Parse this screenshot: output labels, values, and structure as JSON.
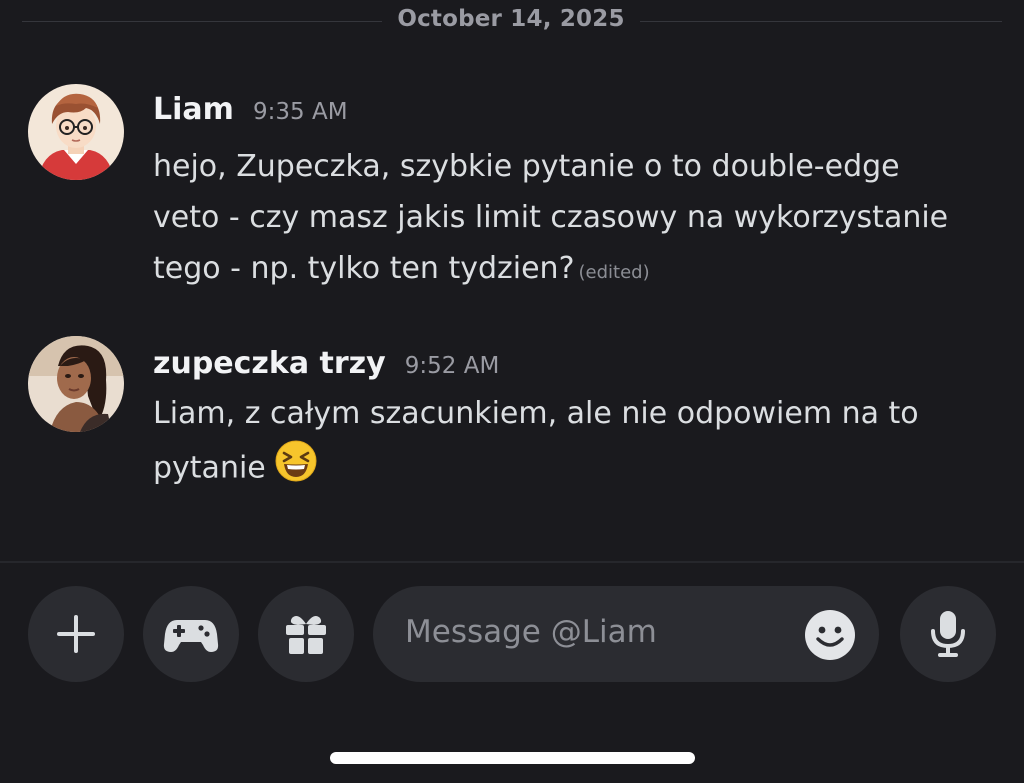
{
  "date_divider": "October 14, 2025",
  "messages": [
    {
      "author": "Liam",
      "time": "9:35 AM",
      "line1": "hejo, Zupeczka, szybkie pytanie o to double-edge",
      "line2": "veto - czy masz jakis limit czasowy na wykorzystanie",
      "line3": "tego - np. tylko ten tydzien?",
      "edited": "(edited)",
      "avatar_icon": "cartoon-avatar-glasses"
    },
    {
      "author": "zupeczka trzy",
      "time": "9:52 AM",
      "line1": "Liam, z całym szacunkiem, ale nie odpowiem na to",
      "line2": "pytanie",
      "emoji": "laughing-face-emoji",
      "avatar_icon": "photo-avatar"
    }
  ],
  "composer": {
    "placeholder": "Message @Liam",
    "buttons": [
      "plus-icon",
      "gamepad-icon",
      "gift-icon",
      "emoji-icon",
      "microphone-icon"
    ]
  },
  "colors": {
    "background": "#1a1a1e",
    "button_bg": "#2b2c31",
    "text_primary": "#f2f3f5",
    "text_muted": "#9a9ba3"
  }
}
